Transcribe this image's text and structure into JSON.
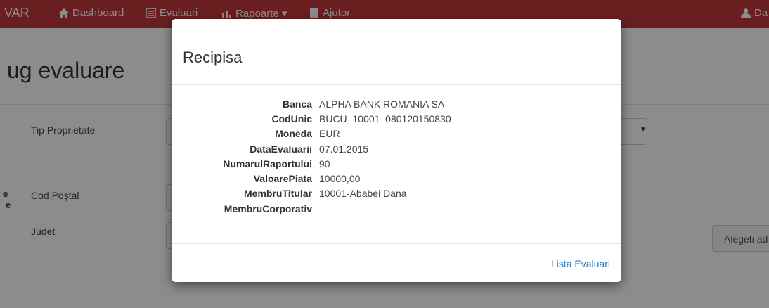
{
  "navbar": {
    "brand": "VAR",
    "items": [
      {
        "label": "Dashboard",
        "icon": "home-icon"
      },
      {
        "label": "Evaluari",
        "icon": "list-icon"
      },
      {
        "label": "Rapoarte ▾",
        "icon": "bar-chart-icon"
      },
      {
        "label": "Ajutor",
        "icon": "book-icon"
      }
    ],
    "user": "Da",
    "color": "#c0393b"
  },
  "page": {
    "title": "ug evaluare",
    "fields": {
      "tip_proprietate": "Tip Proprietate",
      "cod_postal": "Cod Poștal",
      "judet": "Judet"
    },
    "side_letters": [
      "e",
      "e"
    ],
    "right_button": "Alegeti ad"
  },
  "modal": {
    "title": "Recipisa",
    "rows": [
      {
        "label": "Banca",
        "value": "ALPHA BANK ROMANIA SA"
      },
      {
        "label": "CodUnic",
        "value": "BUCU_10001_080120150830"
      },
      {
        "label": "Moneda",
        "value": "EUR"
      },
      {
        "label": "DataEvaluarii",
        "value": "07.01.2015"
      },
      {
        "label": "NumarulRaportului",
        "value": "90"
      },
      {
        "label": "ValoarePiata",
        "value": "10000,00"
      },
      {
        "label": "MembruTitular",
        "value": "10001-Ababei Dana"
      },
      {
        "label": "MembruCorporativ",
        "value": ""
      }
    ],
    "footer_link": "Lista Evaluari",
    "link_color": "#337ab7"
  }
}
